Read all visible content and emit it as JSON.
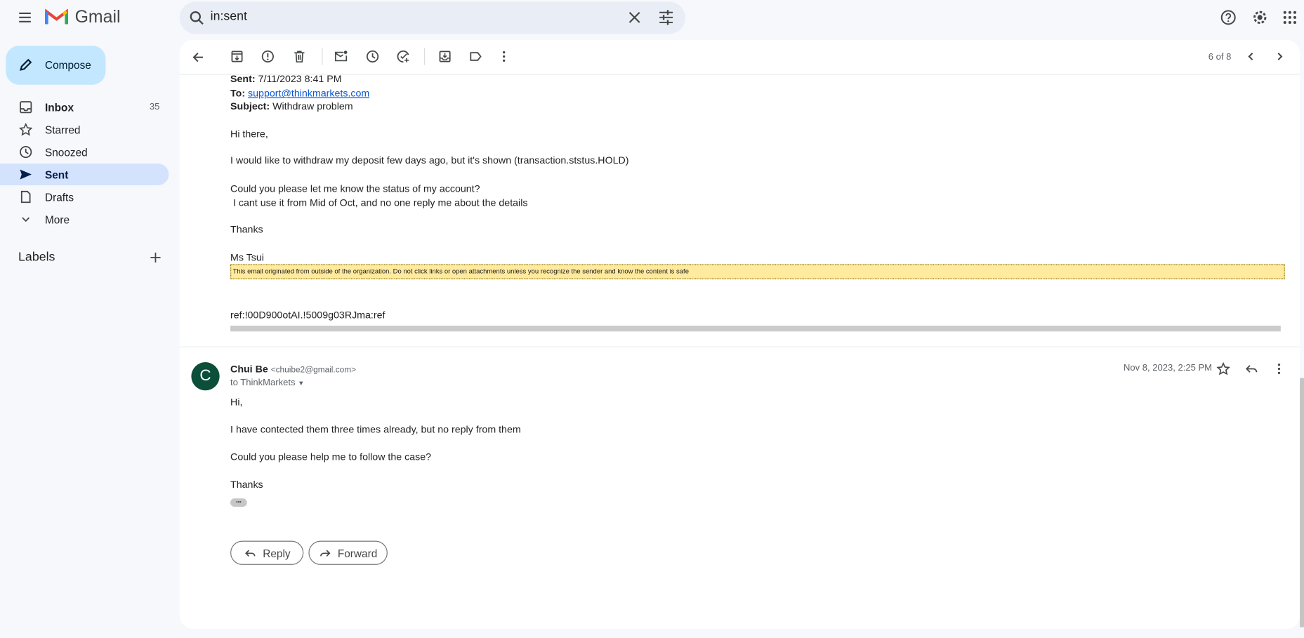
{
  "app": {
    "name": "Gmail"
  },
  "search": {
    "query": "in:sent"
  },
  "compose": {
    "label": "Compose"
  },
  "sidebar": {
    "items": [
      {
        "label": "Inbox",
        "count": "35",
        "icon": "inbox-icon"
      },
      {
        "label": "Starred",
        "icon": "star-icon"
      },
      {
        "label": "Snoozed",
        "icon": "clock-icon"
      },
      {
        "label": "Sent",
        "icon": "send-icon"
      },
      {
        "label": "Drafts",
        "icon": "draft-icon"
      },
      {
        "label": "More",
        "icon": "chevron-down-icon"
      }
    ],
    "labels_heading": "Labels"
  },
  "toolbar": {
    "pagination": "6 of 8"
  },
  "quoted": {
    "sent_label": "Sent:",
    "sent_value": "7/11/2023 8:41 PM",
    "to_label": "To:",
    "to_value": "support@thinkmarkets.com",
    "subject_label": "Subject:",
    "subject_value": "Withdraw problem",
    "lines": [
      "Hi there,",
      "I would like to withdraw my deposit few days ago, but it's shown (transaction.ststus.HOLD)",
      "Could you please let me know the status of my account?",
      " I cant use it from Mid of Oct, and no one reply me about the details",
      "Thanks",
      "Ms Tsui"
    ],
    "banner": "This email originated from outside of the organization. Do not click links or open attachments unless you recognize the sender and know the content is safe",
    "ref": "ref:!00D900otAI.!5009g03RJma:ref"
  },
  "message": {
    "avatar_letter": "C",
    "sender_name": "Chui Be",
    "sender_email": "<chuibe2@gmail.com>",
    "recipient": "to ThinkMarkets",
    "date": "Nov 8, 2023, 2:25 PM",
    "lines": [
      "Hi,",
      "I have contected them three times already, but no reply from them",
      "Could you please help me to follow the case?",
      "Thanks"
    ],
    "ellipsis": "•••"
  },
  "actions": {
    "reply": "Reply",
    "forward": "Forward"
  },
  "colors": {
    "accent": "#0b57d0",
    "avatar": "#0b4e3a",
    "sent_active": "#d3e3fd",
    "compose": "#c2e7ff"
  }
}
